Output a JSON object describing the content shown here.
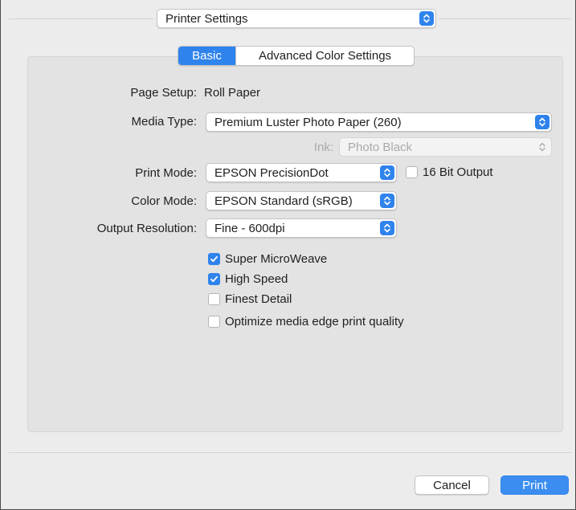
{
  "header": {
    "panel_popup": "Printer Settings"
  },
  "tabs": [
    {
      "label": "Basic",
      "active": true
    },
    {
      "label": "Advanced Color Settings",
      "active": false
    }
  ],
  "fields": {
    "page_setup": {
      "label": "Page Setup:",
      "value": "Roll Paper"
    },
    "media_type": {
      "label": "Media Type:",
      "value": "Premium Luster Photo Paper (260)"
    },
    "ink": {
      "label": "Ink:",
      "value": "Photo Black",
      "enabled": false
    },
    "print_mode": {
      "label": "Print Mode:",
      "value": "EPSON PrecisionDot"
    },
    "sixteen_bit": {
      "label": "16 Bit Output",
      "checked": false
    },
    "color_mode": {
      "label": "Color Mode:",
      "value": "EPSON Standard (sRGB)"
    },
    "output_resolution": {
      "label": "Output Resolution:",
      "value": "Fine - 600dpi"
    }
  },
  "options": [
    {
      "label": "Super MicroWeave",
      "checked": true
    },
    {
      "label": "High Speed",
      "checked": true
    },
    {
      "label": "Finest Detail",
      "checked": false
    },
    {
      "label": "Optimize media edge print quality",
      "checked": false
    }
  ],
  "buttons": {
    "cancel": "Cancel",
    "print": "Print"
  },
  "colors": {
    "accent": "#2f83ec",
    "panel": "#ececec",
    "group": "#e3e3e3"
  }
}
